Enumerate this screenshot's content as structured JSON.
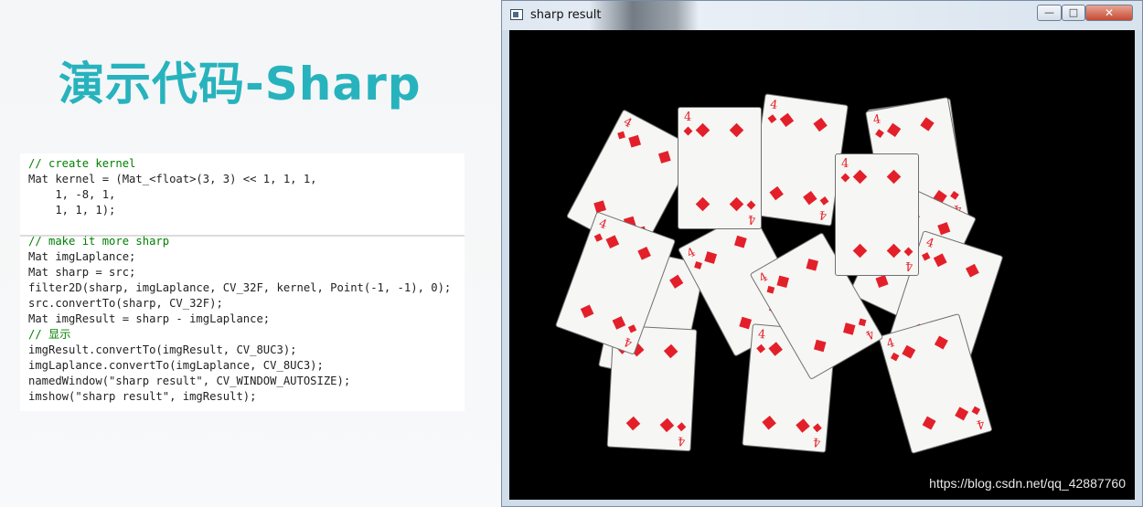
{
  "slide": {
    "title": "演示代码-Sharp"
  },
  "code": {
    "lines": [
      "// create kernel",
      "Mat kernel = (Mat_<float>(3, 3) << 1, 1, 1,",
      "    1, -8, 1,",
      "    1, 1, 1);",
      "// make it more sharp",
      "Mat imgLaplance;",
      "Mat sharp = src;",
      "filter2D(sharp, imgLaplance, CV_32F, kernel, Point(-1, -1), 0);",
      "src.convertTo(sharp, CV_32F);",
      "Mat imgResult = sharp - imgLaplance;",
      "// 显示",
      "imgResult.convertTo(imgResult, CV_8UC3);",
      "imgLaplance.convertTo(imgLaplance, CV_8UC3);",
      "namedWindow(\"sharp result\", CV_WINDOW_AUTOSIZE);",
      "imshow(\"sharp result\", imgResult);"
    ]
  },
  "window": {
    "title": "sharp result",
    "minimize_glyph": "—",
    "maximize_glyph": "□",
    "close_glyph": "✕",
    "card_rank": "4",
    "watermark": "https://blog.csdn.net/qq_42887760"
  },
  "colors": {
    "title_teal": "#27b3bd",
    "card_red": "#e3202a",
    "card_face": "#f6f6f4"
  }
}
